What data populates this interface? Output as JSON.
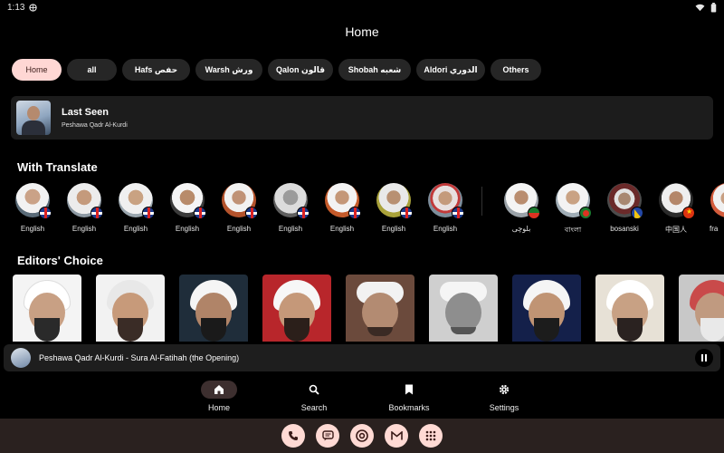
{
  "status_bar": {
    "time": "1:13"
  },
  "app": {
    "title": "Home"
  },
  "chips": [
    {
      "label": "Home",
      "active": true
    },
    {
      "label": "all"
    },
    {
      "label": "Hafs حفص"
    },
    {
      "label": "Warsh ورش"
    },
    {
      "label": "Qalon قالون"
    },
    {
      "label": "Shobah شعبه"
    },
    {
      "label": "Aldori الدوري"
    },
    {
      "label": "Others"
    }
  ],
  "last_seen": {
    "title": "Last Seen",
    "subtitle": "Peshawa Qadr Al-Kurdi"
  },
  "with_translate": {
    "title": "With Translate",
    "reciters": [
      {
        "label": "English",
        "flag": "uk"
      },
      {
        "label": "English",
        "flag": "uk"
      },
      {
        "label": "English",
        "flag": "uk"
      },
      {
        "label": "English",
        "flag": "uk"
      },
      {
        "label": "English",
        "flag": "uk"
      },
      {
        "label": "English",
        "flag": "uk"
      },
      {
        "label": "English",
        "flag": "uk"
      },
      {
        "label": "English",
        "flag": "uk"
      },
      {
        "label": "English",
        "flag": "uk"
      },
      {
        "label": "بلوچی",
        "flag": "mixed"
      },
      {
        "label": "বাংলা",
        "flag": "green"
      },
      {
        "label": "bosanski",
        "flag": "yellow"
      },
      {
        "label": "中国人",
        "flag": "red"
      },
      {
        "label": "fra",
        "flag": "uk"
      }
    ]
  },
  "editors_choice": {
    "title": "Editors' Choice"
  },
  "mini_player": {
    "text": "Peshawa Qadr Al-Kurdi - Sura Al-Fatihah (the Opening)"
  },
  "bottom_nav": [
    {
      "label": "Home",
      "icon": "home-icon",
      "active": true
    },
    {
      "label": "Search",
      "icon": "search-icon"
    },
    {
      "label": "Bookmarks",
      "icon": "bookmark-icon"
    },
    {
      "label": "Settings",
      "icon": "gear-icon"
    }
  ],
  "dock": [
    "phone-icon",
    "messages-icon",
    "chrome-icon",
    "gmail-icon",
    "apps-icon"
  ],
  "colors": {
    "accent": "#ffd7d4",
    "surface": "#1c1c1c",
    "background": "#000000"
  }
}
